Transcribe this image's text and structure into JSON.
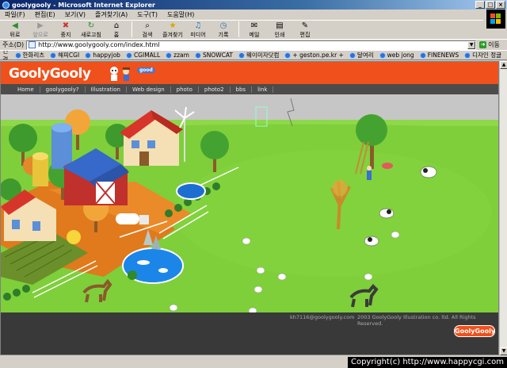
{
  "window": {
    "title": "goolygooly - Microsoft Internet Explorer",
    "buttons": [
      "_",
      "□",
      "×"
    ]
  },
  "menu": {
    "items": [
      "파일(F)",
      "편집(E)",
      "보기(V)",
      "즐겨찾기(A)",
      "도구(T)",
      "도움말(H)"
    ]
  },
  "toolbar": {
    "back": "뒤로",
    "forward": "앞으로",
    "stop": "중지",
    "refresh": "새로고침",
    "home": "홈",
    "search": "검색",
    "favorites": "즐겨찾기",
    "media": "미디어",
    "history": "기록",
    "mail": "메일",
    "print": "인쇄",
    "edit": "편집"
  },
  "address": {
    "label": "주소(D)",
    "url": "http://www.goolygooly.com/index.html",
    "go": "이동"
  },
  "links": {
    "label": "연결",
    "items": [
      "한화리츠",
      "해피CGI",
      "happyjob",
      "CGIMALL",
      "zzam",
      "SNOWCAT",
      "웨이미자닷컴",
      "+ geston.pe.kr +",
      "달여리",
      "web jong",
      "FINENEWS",
      "디자인 정글"
    ]
  },
  "site": {
    "logo": "GoolyGooly",
    "badge": "good",
    "nav": [
      "Home",
      "goolygooly?",
      "Illustration",
      "Web design",
      "photo",
      "photo2",
      "bbs",
      "link"
    ],
    "footer_email": "kh7116@goolygooly.com",
    "footer_copyright": "2003 GoolyGooly Illustration co. ltd. All Rights Reserved.",
    "footer_logo": "GoolyGooly"
  },
  "watermark": "Copyright(c) http://www.happycgi.com",
  "colors": {
    "header": "#f0501c",
    "nav": "#4c4c4c",
    "grass": "#7ecf3a",
    "footer": "#393939"
  }
}
